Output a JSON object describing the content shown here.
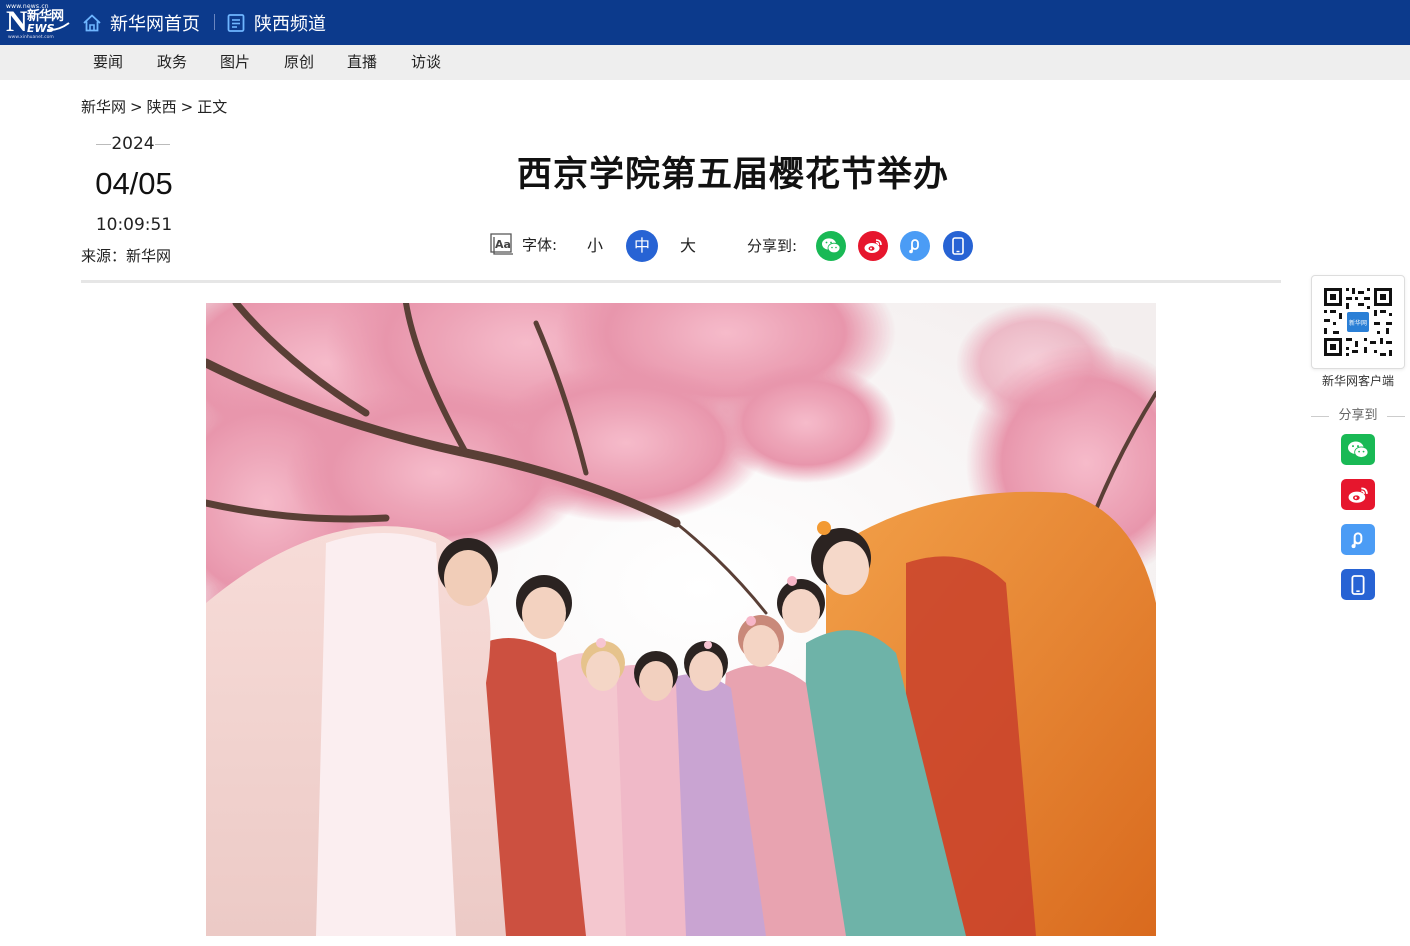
{
  "header": {
    "logo_top_url": "www.news.cn",
    "logo_letter": "N",
    "logo_cn": "新华网",
    "logo_ews": "EWS",
    "logo_bottom_url": "www.xinhuanet.com",
    "home_link": "新华网首页",
    "channel_link": "陕西频道",
    "bg_color": "#0c3a8c"
  },
  "subnav": {
    "items": [
      "要闻",
      "政务",
      "图片",
      "原创",
      "直播",
      "访谈"
    ]
  },
  "breadcrumb": {
    "items": [
      "新华网",
      "陕西",
      "正文"
    ],
    "separator": ">"
  },
  "article": {
    "year": "2024",
    "date": "04/05",
    "time": "10:09:51",
    "source": "来源：新华网",
    "title": "西京学院第五届樱花节举办"
  },
  "tools": {
    "font_label": "字体:",
    "font_sizes": [
      "小",
      "中",
      "大"
    ],
    "font_size_selected": "中",
    "share_label": "分享到:",
    "share_targets": [
      "wechat-icon",
      "weibo-icon",
      "link-icon",
      "mobile-icon"
    ],
    "accent_color": "#2763d4"
  },
  "side_panel": {
    "qr_label": "新华网客户端",
    "qr_center_text": "新华网",
    "share_label": "分享到",
    "share_targets": [
      "wechat-icon",
      "weibo-icon",
      "link-icon",
      "mobile-icon"
    ]
  },
  "colors": {
    "wechat": "#19b955",
    "weibo": "#e6162d",
    "link": "#4b9cf5",
    "mobile": "#2763d4"
  }
}
